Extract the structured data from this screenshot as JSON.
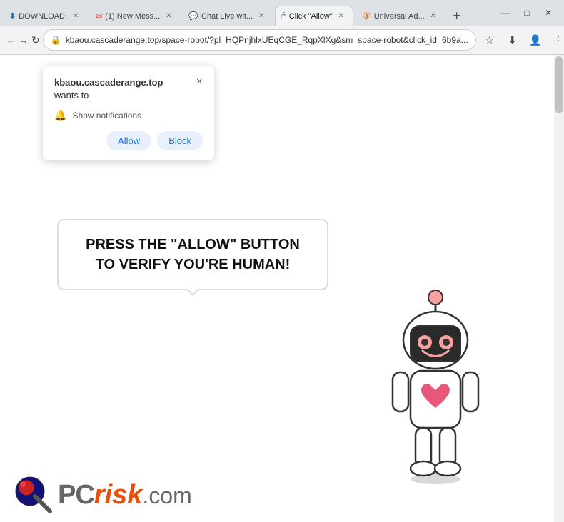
{
  "browser": {
    "tabs": [
      {
        "id": "tab-download",
        "favicon": "↓",
        "title": "DOWNLOAD:",
        "active": false
      },
      {
        "id": "tab-gmail",
        "favicon": "✉",
        "title": "(1) New Mess...",
        "active": false
      },
      {
        "id": "tab-chat",
        "favicon": "💬",
        "title": "Chat Live wit...",
        "active": false
      },
      {
        "id": "tab-allow",
        "favicon": "🖱",
        "title": "Click \"Allow\"",
        "active": true
      },
      {
        "id": "tab-universal",
        "favicon": "🛡",
        "title": "Universal Ad...",
        "active": false
      }
    ],
    "new_tab_label": "+",
    "window_controls": {
      "minimize": "—",
      "maximize": "□",
      "close": "✕"
    },
    "nav": {
      "back": "←",
      "forward": "→",
      "reload": "↻",
      "address_icon": "⟳"
    },
    "address_bar": {
      "url": "kbaou.cascaderange.top/space-robot/?pl=HQPnjhlxUEqCGE_RqpXlXg&sm=space-robot&click_id=6b9a...",
      "star_icon": "☆",
      "download_icon": "↓",
      "profile_icon": "👤",
      "menu_icon": "⋮"
    }
  },
  "notification_popup": {
    "site": "kbaou.cascaderange.top",
    "wants_text": "wants to",
    "close_label": "×",
    "bell_text": "Show notifications",
    "allow_label": "Allow",
    "block_label": "Block"
  },
  "page": {
    "speech_bubble_text": "PRESS THE \"ALLOW\" BUTTON TO VERIFY YOU'RE HUMAN!",
    "background_color": "#ffffff"
  },
  "pcrisk": {
    "pc_text": "PC",
    "risk_text": "risk",
    "com_text": ".com"
  }
}
